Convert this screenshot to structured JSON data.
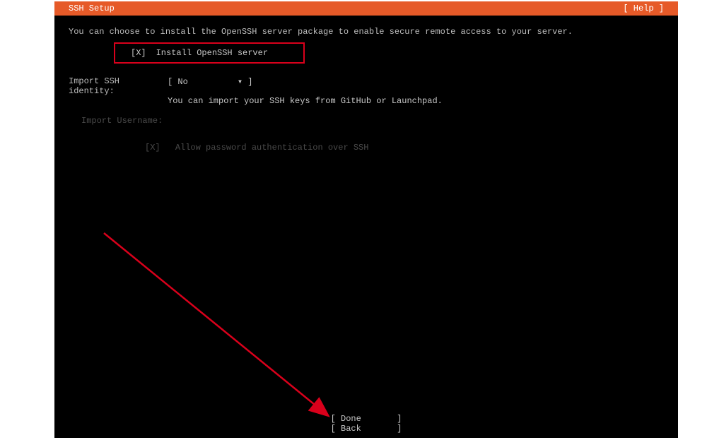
{
  "header": {
    "title": "SSH Setup",
    "help": "[ Help ]"
  },
  "intro": "You can choose to install the OpenSSH server package to enable secure remote access to your server.",
  "install": {
    "checkbox": "[X]",
    "label": "Install OpenSSH server"
  },
  "identity": {
    "label": "Import SSH identity:",
    "value_prefix": "[ ",
    "value": "No",
    "value_suffix": "▾ ]",
    "hint": "You can import your SSH keys from GitHub or Launchpad."
  },
  "username": {
    "label": "Import Username:"
  },
  "password_auth": {
    "checkbox": "[X]",
    "label": "Allow password authentication over SSH"
  },
  "buttons": {
    "done": "[ Done       ]",
    "back": "[ Back       ]"
  }
}
